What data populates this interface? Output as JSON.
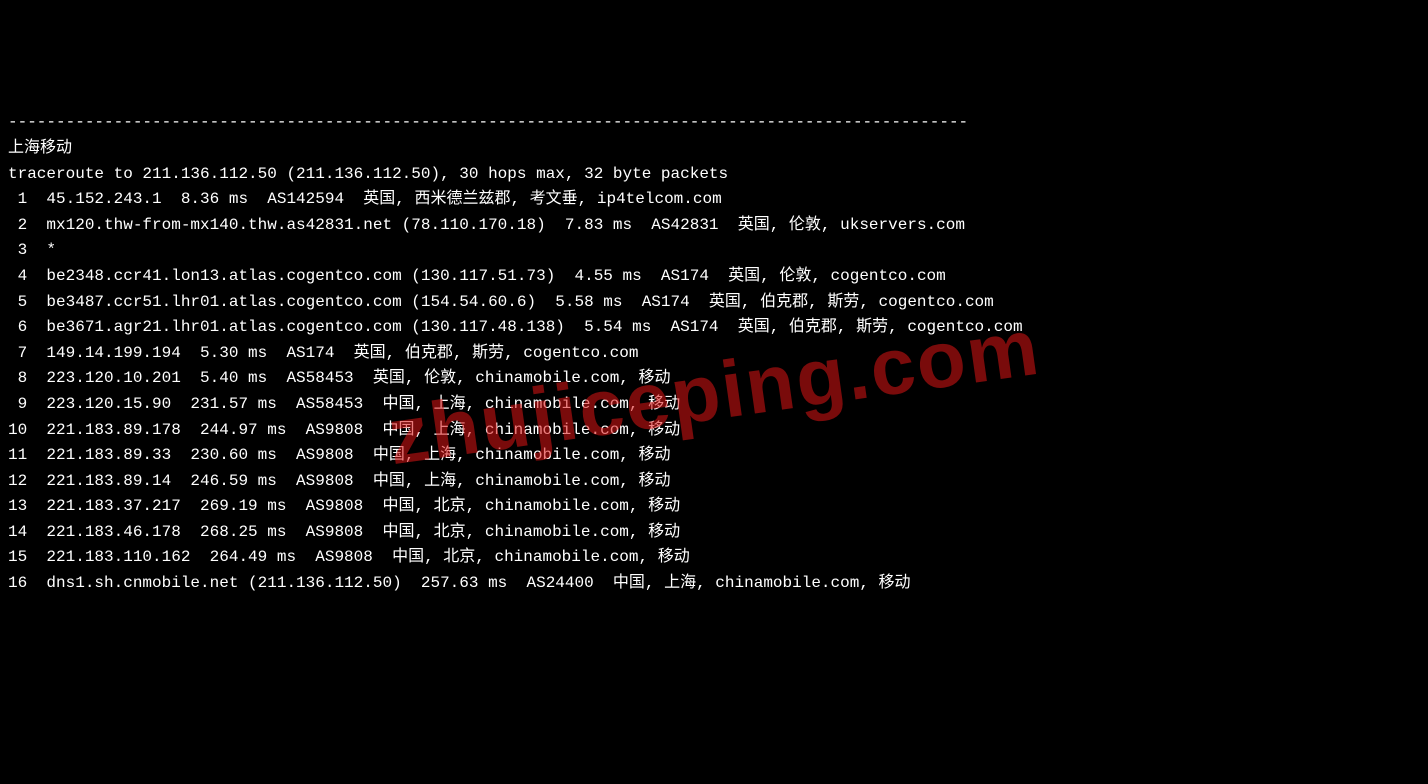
{
  "separator": "----------------------------------------------------------------------------------------------------",
  "header": "上海移动",
  "trace_line": "traceroute to 211.136.112.50 (211.136.112.50), 30 hops max, 32 byte packets",
  "hops": [
    {
      "n": "1",
      "text": "45.152.243.1  8.36 ms  AS142594  英国, 西米德兰兹郡, 考文垂, ip4telcom.com"
    },
    {
      "n": "2",
      "text": "mx120.thw-from-mx140.thw.as42831.net (78.110.170.18)  7.83 ms  AS42831  英国, 伦敦, ukservers.com"
    },
    {
      "n": "3",
      "text": "*"
    },
    {
      "n": "4",
      "text": "be2348.ccr41.lon13.atlas.cogentco.com (130.117.51.73)  4.55 ms  AS174  英国, 伦敦, cogentco.com"
    },
    {
      "n": "5",
      "text": "be3487.ccr51.lhr01.atlas.cogentco.com (154.54.60.6)  5.58 ms  AS174  英国, 伯克郡, 斯劳, cogentco.com"
    },
    {
      "n": "6",
      "text": "be3671.agr21.lhr01.atlas.cogentco.com (130.117.48.138)  5.54 ms  AS174  英国, 伯克郡, 斯劳, cogentco.com"
    },
    {
      "n": "7",
      "text": "149.14.199.194  5.30 ms  AS174  英国, 伯克郡, 斯劳, cogentco.com"
    },
    {
      "n": "8",
      "text": "223.120.10.201  5.40 ms  AS58453  英国, 伦敦, chinamobile.com, 移动"
    },
    {
      "n": "9",
      "text": "223.120.15.90  231.57 ms  AS58453  中国, 上海, chinamobile.com, 移动"
    },
    {
      "n": "10",
      "text": "221.183.89.178  244.97 ms  AS9808  中国, 上海, chinamobile.com, 移动"
    },
    {
      "n": "11",
      "text": "221.183.89.33  230.60 ms  AS9808  中国, 上海, chinamobile.com, 移动"
    },
    {
      "n": "12",
      "text": "221.183.89.14  246.59 ms  AS9808  中国, 上海, chinamobile.com, 移动"
    },
    {
      "n": "13",
      "text": "221.183.37.217  269.19 ms  AS9808  中国, 北京, chinamobile.com, 移动"
    },
    {
      "n": "14",
      "text": "221.183.46.178  268.25 ms  AS9808  中国, 北京, chinamobile.com, 移动"
    },
    {
      "n": "15",
      "text": "221.183.110.162  264.49 ms  AS9808  中国, 北京, chinamobile.com, 移动"
    },
    {
      "n": "16",
      "text": "dns1.sh.cnmobile.net (211.136.112.50)  257.63 ms  AS24400  中国, 上海, chinamobile.com, 移动"
    }
  ],
  "watermark": "zhujiceping.com"
}
